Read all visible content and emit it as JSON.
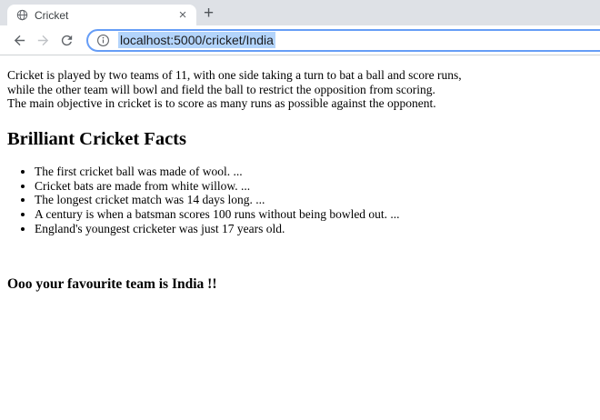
{
  "browser": {
    "tab_title": "Cricket",
    "tab_close_glyph": "×",
    "new_tab_glyph": "+",
    "url": "localhost:5000/cricket/India",
    "icons": {
      "favicon": "globe-icon",
      "address_info": "info-icon",
      "back": "back-arrow-icon",
      "forward": "forward-arrow-icon",
      "reload": "reload-icon"
    },
    "colors": {
      "tab_bar_bg": "#dee1e6",
      "active_tab_bg": "#ffffff",
      "focus_ring": "#669df6",
      "selection_highlight": "#b3d4fb",
      "icon_gray": "#5f6368",
      "icon_disabled": "#c0c3c7"
    }
  },
  "content": {
    "intro_lines": [
      "Cricket is played by two teams of 11, with one side taking a turn to bat a ball and score runs,",
      "while the other team will bowl and field the ball to restrict the opposition from scoring.",
      "The main objective in cricket is to score as many runs as possible against the opponent."
    ],
    "heading": "Brilliant Cricket Facts",
    "facts": [
      "The first cricket ball was made of wool. ...",
      "Cricket bats are made from white willow. ...",
      "The longest cricket match was 14 days long. ...",
      "A century is when a batsman scores 100 runs without being bowled out. ...",
      "England's youngest cricketer was just 17 years old."
    ],
    "footer_text": "Ooo your favourite team is India !!"
  }
}
